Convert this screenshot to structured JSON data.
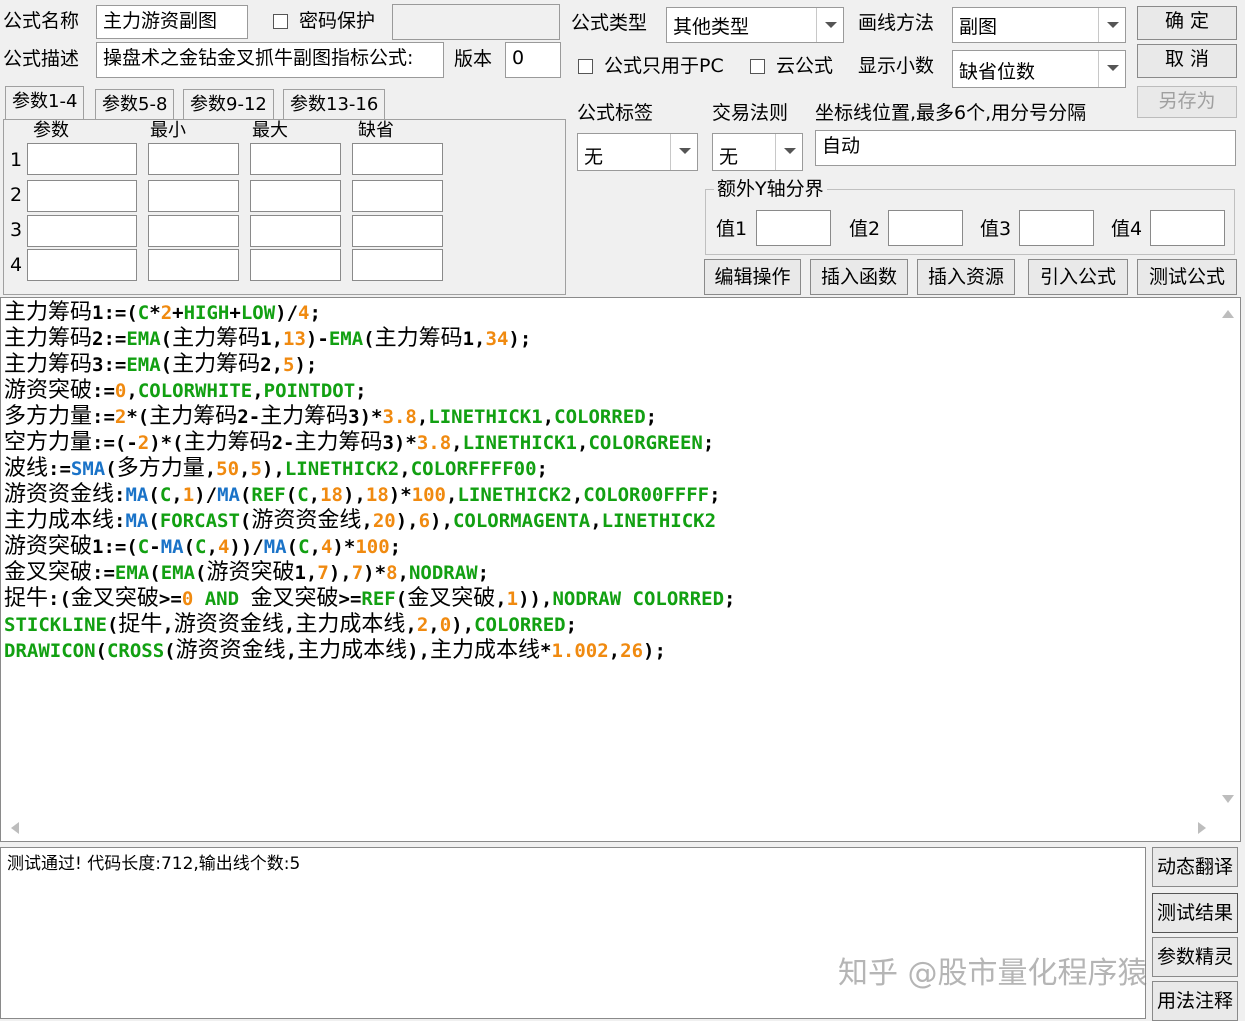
{
  "header": {
    "name_label": "公式名称",
    "name_value": "主力游资副图",
    "password_label": "密码保护",
    "desc_label": "公式描述",
    "desc_value": "操盘术之金钻金叉抓牛副图指标公式:",
    "version_label": "版本",
    "version_value": "0",
    "type_label": "公式类型",
    "type_value": "其他类型",
    "draw_label": "画线方法",
    "draw_value": "副图",
    "pc_only_label": "公式只用于PC",
    "cloud_label": "云公式",
    "decimals_label": "显示小数",
    "decimals_value": "缺省位数",
    "ok_button": "确  定",
    "cancel_button": "取  消",
    "saveas_button": "另存为"
  },
  "params": {
    "tabs": [
      "参数1-4",
      "参数5-8",
      "参数9-12",
      "参数13-16"
    ],
    "col_headers": [
      "参数",
      "最小",
      "最大",
      "缺省"
    ],
    "rows": [
      "1",
      "2",
      "3",
      "4"
    ]
  },
  "options": {
    "tag_label": "公式标签",
    "tag_value": "无",
    "trade_label": "交易法则",
    "trade_value": "无",
    "axis_label": "坐标线位置,最多6个,用分号分隔",
    "axis_value": "自动",
    "yaxis_group_label": "额外Y轴分界",
    "y_labels": [
      "值1",
      "值2",
      "值3",
      "值4"
    ]
  },
  "actions": [
    "编辑操作",
    "插入函数",
    "插入资源",
    "引入公式",
    "测试公式"
  ],
  "code_lines": [
    [
      [
        "c",
        "主力筹码"
      ],
      [
        "s",
        "1:=("
      ],
      [
        "k",
        "C"
      ],
      [
        "s",
        "*"
      ],
      [
        "n",
        "2"
      ],
      [
        "s",
        "+"
      ],
      [
        "k",
        "HIGH"
      ],
      [
        "s",
        "+"
      ],
      [
        "k",
        "LOW"
      ],
      [
        "s",
        ")/"
      ],
      [
        "n",
        "4"
      ],
      [
        "s",
        ";"
      ]
    ],
    [
      [
        "c",
        "主力筹码"
      ],
      [
        "s",
        "2:="
      ],
      [
        "k",
        "EMA"
      ],
      [
        "s",
        "("
      ],
      [
        "c",
        "主力筹码"
      ],
      [
        "s",
        "1,"
      ],
      [
        "n",
        "13"
      ],
      [
        "s",
        ")-"
      ],
      [
        "k",
        "EMA"
      ],
      [
        "s",
        "("
      ],
      [
        "c",
        "主力筹码"
      ],
      [
        "s",
        "1,"
      ],
      [
        "n",
        "34"
      ],
      [
        "s",
        ");"
      ]
    ],
    [
      [
        "c",
        "主力筹码"
      ],
      [
        "s",
        "3:="
      ],
      [
        "k",
        "EMA"
      ],
      [
        "s",
        "("
      ],
      [
        "c",
        "主力筹码"
      ],
      [
        "s",
        "2,"
      ],
      [
        "n",
        "5"
      ],
      [
        "s",
        ");"
      ]
    ],
    [
      [
        "c",
        "游资突破"
      ],
      [
        "s",
        ":="
      ],
      [
        "n",
        "0"
      ],
      [
        "s",
        ","
      ],
      [
        "k",
        "COLORWHITE"
      ],
      [
        "s",
        ","
      ],
      [
        "k",
        "POINTDOT"
      ],
      [
        "s",
        ";"
      ]
    ],
    [
      [
        "c",
        "多方力量"
      ],
      [
        "s",
        ":="
      ],
      [
        "n",
        "2"
      ],
      [
        "s",
        "*("
      ],
      [
        "c",
        "主力筹码"
      ],
      [
        "s",
        "2-"
      ],
      [
        "c",
        "主力筹码"
      ],
      [
        "s",
        "3)*"
      ],
      [
        "n",
        "3.8"
      ],
      [
        "s",
        ","
      ],
      [
        "k",
        "LINETHICK1"
      ],
      [
        "s",
        ","
      ],
      [
        "k",
        "COLORRED"
      ],
      [
        "s",
        ";"
      ]
    ],
    [
      [
        "c",
        "空方力量"
      ],
      [
        "s",
        ":=(-"
      ],
      [
        "n",
        "2"
      ],
      [
        "s",
        ")*("
      ],
      [
        "c",
        "主力筹码"
      ],
      [
        "s",
        "2-"
      ],
      [
        "c",
        "主力筹码"
      ],
      [
        "s",
        "3)*"
      ],
      [
        "n",
        "3.8"
      ],
      [
        "s",
        ","
      ],
      [
        "k",
        "LINETHICK1"
      ],
      [
        "s",
        ","
      ],
      [
        "k",
        "COLORGREEN"
      ],
      [
        "s",
        ";"
      ]
    ],
    [
      [
        "c",
        "波线"
      ],
      [
        "s",
        ":="
      ],
      [
        "f",
        "SMA"
      ],
      [
        "s",
        "("
      ],
      [
        "c",
        "多方力量"
      ],
      [
        "s",
        ","
      ],
      [
        "n",
        "50"
      ],
      [
        "s",
        ","
      ],
      [
        "n",
        "5"
      ],
      [
        "s",
        "),"
      ],
      [
        "k",
        "LINETHICK2"
      ],
      [
        "s",
        ","
      ],
      [
        "k",
        "COLORFFFF00"
      ],
      [
        "s",
        ";"
      ]
    ],
    [
      [
        "c",
        "游资资金线"
      ],
      [
        "s",
        ":"
      ],
      [
        "f",
        "MA"
      ],
      [
        "s",
        "("
      ],
      [
        "k",
        "C"
      ],
      [
        "s",
        ","
      ],
      [
        "n",
        "1"
      ],
      [
        "s",
        ")/"
      ],
      [
        "f",
        "MA"
      ],
      [
        "s",
        "("
      ],
      [
        "k",
        "REF"
      ],
      [
        "s",
        "("
      ],
      [
        "k",
        "C"
      ],
      [
        "s",
        ","
      ],
      [
        "n",
        "18"
      ],
      [
        "s",
        "),"
      ],
      [
        "n",
        "18"
      ],
      [
        "s",
        ")*"
      ],
      [
        "n",
        "100"
      ],
      [
        "s",
        ","
      ],
      [
        "k",
        "LINETHICK2"
      ],
      [
        "s",
        ","
      ],
      [
        "k",
        "COLOR00FFFF"
      ],
      [
        "s",
        ";"
      ]
    ],
    [
      [
        "c",
        "主力成本线"
      ],
      [
        "s",
        ":"
      ],
      [
        "f",
        "MA"
      ],
      [
        "s",
        "("
      ],
      [
        "k",
        "FORCAST"
      ],
      [
        "s",
        "("
      ],
      [
        "c",
        "游资资金线"
      ],
      [
        "s",
        ","
      ],
      [
        "n",
        "20"
      ],
      [
        "s",
        "),"
      ],
      [
        "n",
        "6"
      ],
      [
        "s",
        "),"
      ],
      [
        "k",
        "COLORMAGENTA"
      ],
      [
        "s",
        ","
      ],
      [
        "k",
        "LINETHICK2"
      ]
    ],
    [
      [
        "c",
        "游资突破"
      ],
      [
        "s",
        "1:=("
      ],
      [
        "k",
        "C"
      ],
      [
        "s",
        "-"
      ],
      [
        "f",
        "MA"
      ],
      [
        "s",
        "("
      ],
      [
        "k",
        "C"
      ],
      [
        "s",
        ","
      ],
      [
        "n",
        "4"
      ],
      [
        "s",
        "))/"
      ],
      [
        "f",
        "MA"
      ],
      [
        "s",
        "("
      ],
      [
        "k",
        "C"
      ],
      [
        "s",
        ","
      ],
      [
        "n",
        "4"
      ],
      [
        "s",
        ")*"
      ],
      [
        "n",
        "100"
      ],
      [
        "s",
        ";"
      ]
    ],
    [
      [
        "c",
        "金叉突破"
      ],
      [
        "s",
        ":="
      ],
      [
        "k",
        "EMA"
      ],
      [
        "s",
        "("
      ],
      [
        "k",
        "EMA"
      ],
      [
        "s",
        "("
      ],
      [
        "c",
        "游资突破"
      ],
      [
        "s",
        "1,"
      ],
      [
        "n",
        "7"
      ],
      [
        "s",
        "),"
      ],
      [
        "n",
        "7"
      ],
      [
        "s",
        ")*"
      ],
      [
        "n",
        "8"
      ],
      [
        "s",
        ","
      ],
      [
        "k",
        "NODRAW"
      ],
      [
        "s",
        ";"
      ]
    ],
    [
      [
        "c",
        "捉牛"
      ],
      [
        "s",
        ":("
      ],
      [
        "c",
        "金叉突破"
      ],
      [
        "s",
        ">="
      ],
      [
        "n",
        "0"
      ],
      [
        "s",
        " "
      ],
      [
        "k",
        "AND"
      ],
      [
        "s",
        " "
      ],
      [
        "c",
        "金叉突破"
      ],
      [
        "s",
        ">="
      ],
      [
        "k",
        "REF"
      ],
      [
        "s",
        "("
      ],
      [
        "c",
        "金叉突破"
      ],
      [
        "s",
        ","
      ],
      [
        "n",
        "1"
      ],
      [
        "s",
        "))"
      ],
      [
        "s",
        ","
      ],
      [
        "k",
        "NODRAW COLORRED"
      ],
      [
        "s",
        ";"
      ]
    ],
    [
      [
        "k",
        "STICKLINE"
      ],
      [
        "s",
        "("
      ],
      [
        "c",
        "捉牛"
      ],
      [
        "s",
        ","
      ],
      [
        "c",
        "游资资金线"
      ],
      [
        "s",
        ","
      ],
      [
        "c",
        "主力成本线"
      ],
      [
        "s",
        ","
      ],
      [
        "n",
        "2"
      ],
      [
        "s",
        ","
      ],
      [
        "n",
        "0"
      ],
      [
        "s",
        "),"
      ],
      [
        "k",
        "COLORRED"
      ],
      [
        "s",
        ";"
      ]
    ],
    [
      [
        "k",
        "DRAWICON"
      ],
      [
        "s",
        "("
      ],
      [
        "k",
        "CROSS"
      ],
      [
        "s",
        "("
      ],
      [
        "c",
        "游资资金线"
      ],
      [
        "s",
        ","
      ],
      [
        "c",
        "主力成本线"
      ],
      [
        "s",
        "),"
      ],
      [
        "c",
        "主力成本线"
      ],
      [
        "s",
        "*"
      ],
      [
        "n",
        "1.002"
      ],
      [
        "s",
        ","
      ],
      [
        "n",
        "26"
      ],
      [
        "s",
        ");"
      ]
    ]
  ],
  "status_message": "测试通过! 代码长度:712,输出线个数:5",
  "side_buttons": [
    "动态翻译",
    "测试结果",
    "参数精灵",
    "用法注释"
  ],
  "watermark": "知乎 @股市量化程序猿"
}
